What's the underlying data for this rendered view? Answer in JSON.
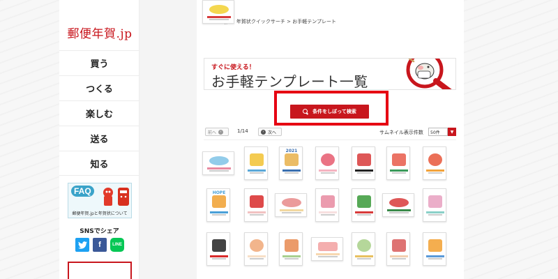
{
  "site": {
    "logo": "郵便年賀.jp"
  },
  "sidebar": {
    "items": [
      {
        "label": "買う"
      },
      {
        "label": "つくる"
      },
      {
        "label": "楽しむ"
      },
      {
        "label": "送る"
      },
      {
        "label": "知る"
      }
    ],
    "faq": {
      "label": "FAQ",
      "caption": "郵便年賀.jpと年賀状について"
    },
    "sns": {
      "title": "SNSでシェア",
      "twitter": "t",
      "facebook": "f",
      "line": "LINE"
    }
  },
  "main": {
    "breadcrumb": "郵便年賀.jp > 年賀状クイックサーチ > お手軽テンプレート",
    "hero": {
      "subtitle": "すぐに使える！",
      "title": "お手軽テンプレート一覧"
    },
    "search_button": "条件をしぼって検索",
    "pager": {
      "prev": "前へ",
      "next": "次へ",
      "count": "1/14",
      "per_page_label": "サムネイル表示件数",
      "per_page_value": "50件"
    },
    "thumbnails": [
      {
        "id": "thumb-1",
        "accent": "#7fc3e6",
        "accent2": "#e88aa0",
        "orientation": "landscape"
      },
      {
        "id": "thumb-2",
        "accent": "#f2c232",
        "accent2": "#5aa8d8",
        "orientation": "portrait"
      },
      {
        "id": "thumb-3",
        "accent": "#e8b04a",
        "accent2": "#3a6fb0",
        "orientation": "portrait",
        "text": "2021"
      },
      {
        "id": "thumb-4",
        "accent": "#e65a6e",
        "accent2": "#f5b3c0",
        "orientation": "portrait"
      },
      {
        "id": "thumb-5",
        "accent": "#d83a3a",
        "accent2": "#222222",
        "orientation": "portrait"
      },
      {
        "id": "thumb-6",
        "accent": "#e85a4a",
        "accent2": "#3a9a5a",
        "orientation": "portrait"
      },
      {
        "id": "thumb-7",
        "accent": "#e8563a",
        "accent2": "#f2a23a",
        "orientation": "portrait"
      },
      {
        "id": "thumb-8",
        "accent": "#f0a030",
        "accent2": "#4aa0d8",
        "orientation": "portrait",
        "text": "HOPE"
      },
      {
        "id": "thumb-9",
        "accent": "#d82a2a",
        "accent2": "#f2c2c2",
        "orientation": "portrait"
      },
      {
        "id": "thumb-10",
        "accent": "#e88a8a",
        "accent2": "#f2d8a0",
        "orientation": "landscape"
      },
      {
        "id": "thumb-11",
        "accent": "#e88aa0",
        "accent2": "#f8e0e0",
        "orientation": "portrait"
      },
      {
        "id": "thumb-12",
        "accent": "#3a9a3a",
        "accent2": "#d83a3a",
        "orientation": "portrait"
      },
      {
        "id": "thumb-13",
        "accent": "#d83a3a",
        "accent2": "#3a8a4a",
        "orientation": "landscape"
      },
      {
        "id": "thumb-14",
        "accent": "#e8a0c0",
        "accent2": "#8ad0c8",
        "orientation": "portrait"
      },
      {
        "id": "thumb-15",
        "accent": "#222222",
        "accent2": "#d82a2a",
        "orientation": "portrait"
      },
      {
        "id": "thumb-16",
        "accent": "#f0a878",
        "accent2": "#f8e0c8",
        "orientation": "portrait"
      },
      {
        "id": "thumb-17",
        "accent": "#e88a50",
        "accent2": "#a8d090",
        "orientation": "portrait"
      },
      {
        "id": "thumb-18",
        "accent": "#f2a0a0",
        "accent2": "#f8d8b0",
        "orientation": "landscape"
      },
      {
        "id": "thumb-19",
        "accent": "#a8d088",
        "accent2": "#e8c060",
        "orientation": "portrait"
      },
      {
        "id": "thumb-20",
        "accent": "#d85a5a",
        "accent2": "#f2d0b0",
        "orientation": "portrait"
      },
      {
        "id": "thumb-21",
        "accent": "#f2a030",
        "accent2": "#5a9ad8",
        "orientation": "portrait"
      },
      {
        "id": "thumb-22",
        "accent": "#f2d030",
        "accent2": "#d83a3a",
        "orientation": "landscape"
      }
    ]
  },
  "colors": {
    "brand": "#c8161d",
    "highlight": "#e60012",
    "background": "#f4f4f4"
  }
}
